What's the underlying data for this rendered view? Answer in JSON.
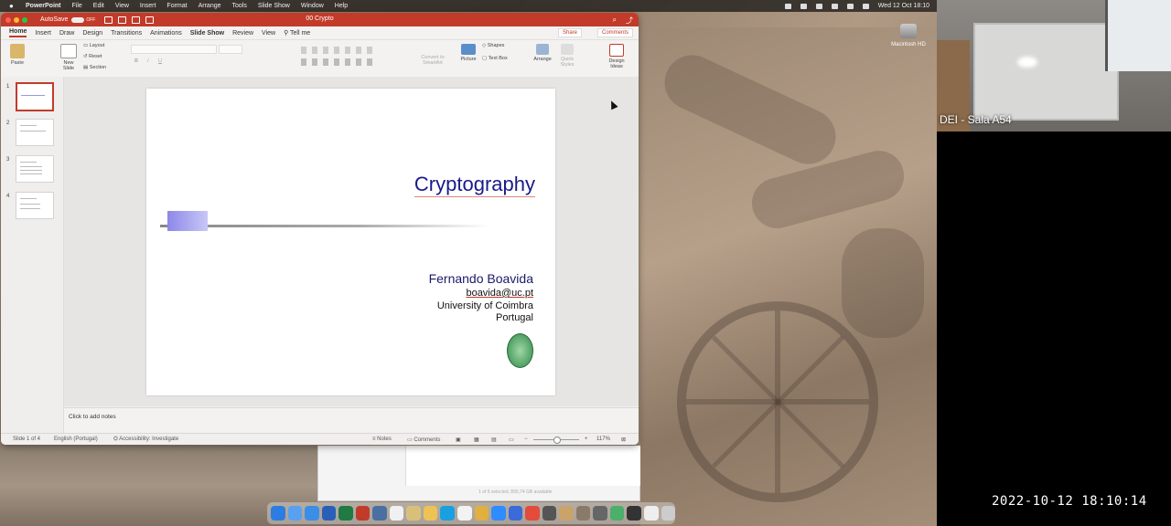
{
  "menubar": {
    "app_name": "PowerPoint",
    "menus": [
      "File",
      "Edit",
      "View",
      "Insert",
      "Format",
      "Arrange",
      "Tools",
      "Slide Show",
      "Window",
      "Help"
    ],
    "clock": "Wed 12 Oct 18:10"
  },
  "desktop": {
    "disk_label": "Macintosh HD"
  },
  "window": {
    "title": "00 Crypto",
    "autosave_label": "AutoSave",
    "autosave_state": "OFF",
    "accent_color": "#c23b2a"
  },
  "tabs": [
    "Home",
    "Insert",
    "Draw",
    "Design",
    "Transitions",
    "Animations",
    "Slide Show",
    "Review",
    "View",
    "Tell me"
  ],
  "share_label": "Share",
  "comments_label": "Comments",
  "ribbon": {
    "paste": "Paste",
    "new_slide": "New Slide",
    "layout": "Layout",
    "reset": "Reset",
    "section": "Section",
    "convert": "Convert to SmartArt",
    "picture": "Picture",
    "shapes": "Shapes",
    "text_box": "Text Box",
    "arrange": "Arrange",
    "quick_styles": "Quick Styles",
    "design_ideas": "Design Ideas"
  },
  "thumbnails": [
    "1",
    "2",
    "3",
    "4"
  ],
  "slide": {
    "title": "Cryptography",
    "author": "Fernando Boavida",
    "email": "boavida@uc.pt",
    "institution": "University of Coimbra",
    "country": "Portugal"
  },
  "notes_placeholder": "Click to add notes",
  "status": {
    "slide_counter": "Slide 1 of 4",
    "language": "English (Portugal)",
    "accessibility": "Accessibility: Investigate",
    "notes_btn": "Notes",
    "comments_btn": "Comments",
    "zoom": "117%"
  },
  "behind_window_text": "1 of 6 selected, 890,74 GB available",
  "camera": {
    "room_label": "DEI - Sala A54"
  },
  "recording_timestamp": "2022-10-12  18:10:14"
}
